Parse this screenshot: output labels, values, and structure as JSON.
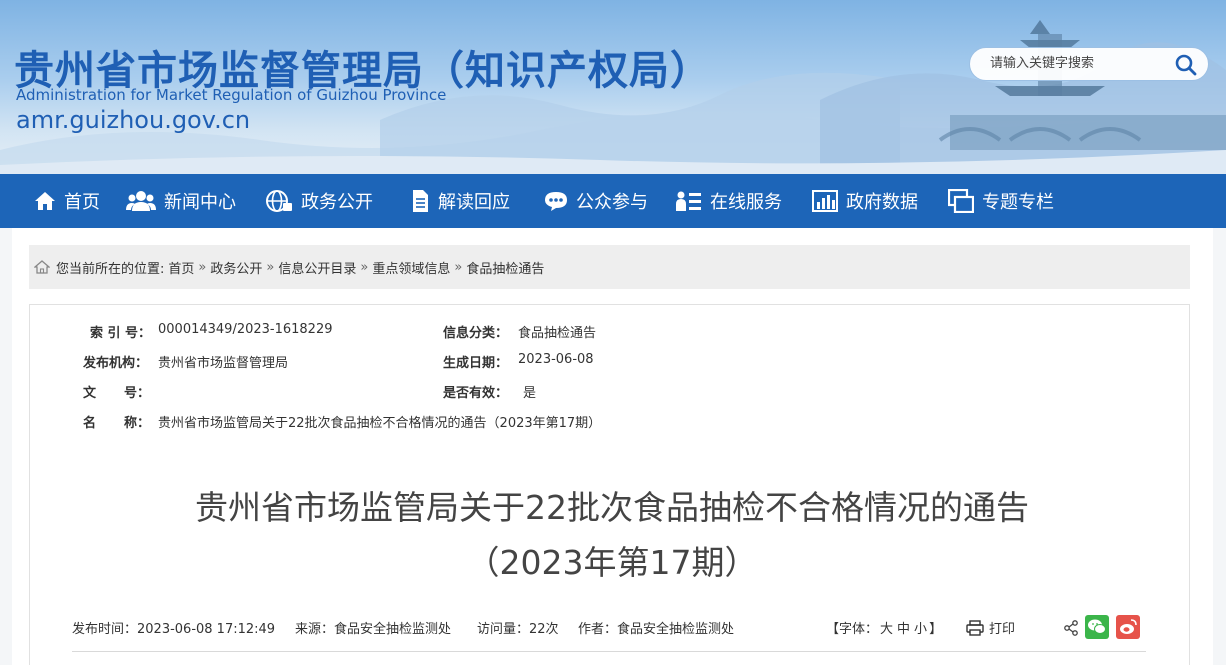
{
  "header": {
    "site_title": "贵州省市场监督管理局（知识产权局）",
    "site_subtitle": "Administration for Market Regulation of Guizhou Province",
    "site_domain": "amr.guizhou.gov.cn",
    "search_placeholder": "请输入关键字搜索",
    "search_icon": "search-icon"
  },
  "nav": {
    "items": [
      {
        "label": "首页",
        "icon": "home-icon"
      },
      {
        "label": "新闻中心",
        "icon": "people-icon"
      },
      {
        "label": "政务公开",
        "icon": "globe-icon"
      },
      {
        "label": "解读回应",
        "icon": "document-icon"
      },
      {
        "label": "公众参与",
        "icon": "chat-icon"
      },
      {
        "label": "在线服务",
        "icon": "list-icon"
      },
      {
        "label": "政府数据",
        "icon": "bar-chart-icon"
      },
      {
        "label": "专题专栏",
        "icon": "windows-icon"
      }
    ]
  },
  "breadcrumb": {
    "prefix": "您当前所在的位置:",
    "items": [
      "首页",
      "政务公开",
      "信息公开目录",
      "重点领域信息",
      "食品抽检通告"
    ],
    "separator": "»"
  },
  "meta": {
    "index_label": "索 引 号：",
    "index_value": "000014349/2023-1618229",
    "category_label": "信息分类：",
    "category_value": "食品抽检通告",
    "publisher_label": "发布机构：",
    "publisher_value": "贵州省市场监督管理局",
    "date_label": "生成日期：",
    "date_value": "2023-06-08",
    "docno_label_1": "文",
    "docno_label_2": "号：",
    "docno_value": "",
    "valid_label": "是否有效：",
    "valid_value": "是",
    "name_label_1": "名",
    "name_label_2": "称：",
    "name_value": "贵州省市场监管局关于22批次食品抽检不合格情况的通告（2023年第17期）"
  },
  "article": {
    "title_line1": "贵州省市场监管局关于22批次食品抽检不合格情况的通告",
    "title_line2": "（2023年第17期）"
  },
  "info": {
    "publish_time": "发布时间：2023-06-08 17:12:49",
    "source": "来源：食品安全抽检监测处",
    "views": "访问量：22次",
    "author": "作者：食品安全抽检监测处",
    "font_prefix": "【字体：",
    "font_large": "大",
    "font_medium": "中",
    "font_small": "小",
    "font_suffix": "】",
    "print_label": "打印"
  },
  "colors": {
    "brand_blue": "#1d65b8",
    "title_blue": "#1f5fb4",
    "wechat_green": "#3bb54a",
    "weibo_red": "#e6534a"
  }
}
